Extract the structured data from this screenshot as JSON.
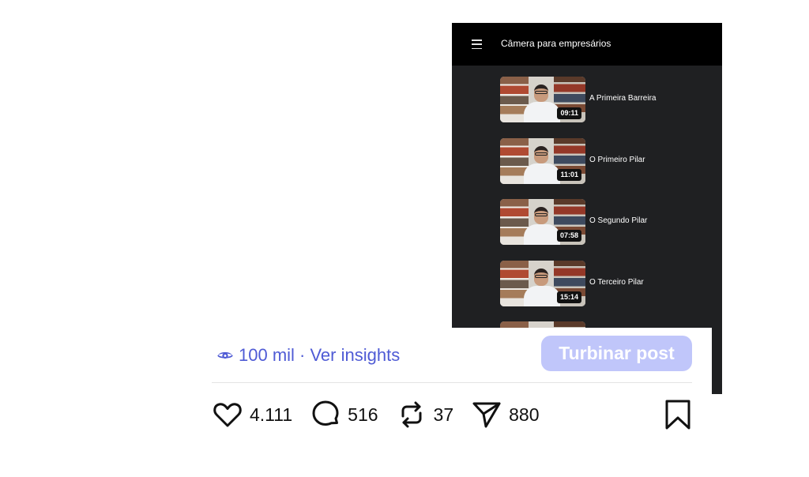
{
  "app": {
    "title": "Câmera para empresários",
    "lessons": [
      {
        "title": "A Primeira Barreira",
        "duration": "09:11"
      },
      {
        "title": "O Primeiro Pilar",
        "duration": "11:01"
      },
      {
        "title": "O Segundo Pilar",
        "duration": "07:58"
      },
      {
        "title": "O Terceiro Pilar",
        "duration": "15:14"
      }
    ]
  },
  "post": {
    "views_label": "100 mil · Ver insights",
    "boost_label": "Turbinar post",
    "likes": "4.111",
    "comments": "516",
    "reposts": "37",
    "shares": "880"
  },
  "colors": {
    "accent": "#4f5bd5",
    "boost_bg": "#c0c6fa",
    "app_bg": "#1f2022"
  }
}
